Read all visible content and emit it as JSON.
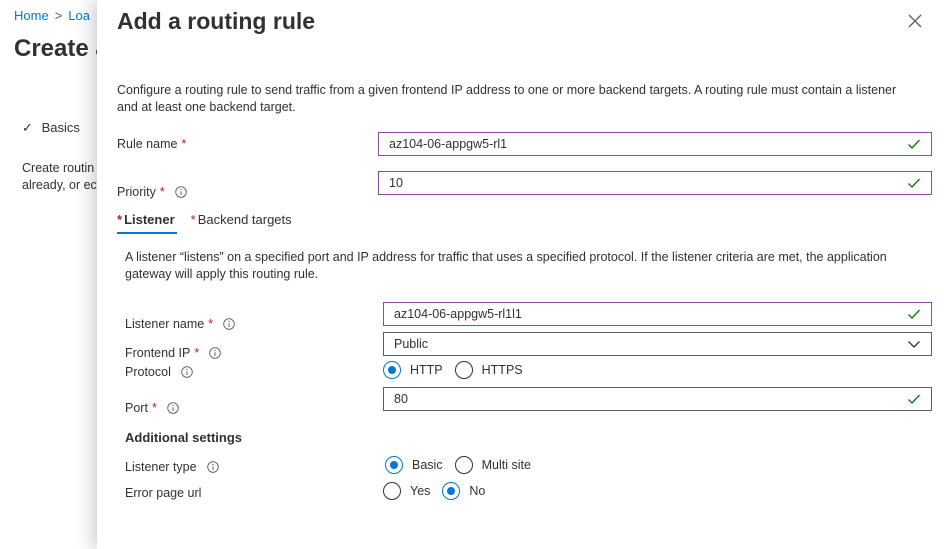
{
  "background": {
    "breadcrumb_home": "Home",
    "breadcrumb_next": "Loa",
    "page_title": "Create a",
    "step_label": "Basics",
    "desc_line1": "Create routin",
    "desc_line2": "already, or ec"
  },
  "panel": {
    "title": "Add a routing rule",
    "intro": "Configure a routing rule to send traffic from a given frontend IP address to one or more backend targets. A routing rule must contain a listener and at least one backend target.",
    "rule_name_label": "Rule name",
    "rule_name_value": "az104-06-appgw5-rl1",
    "priority_label": "Priority",
    "priority_value": "10",
    "required_mark": "*",
    "tabs": [
      {
        "label": "Listener",
        "active": true
      },
      {
        "label": "Backend targets",
        "active": false
      }
    ],
    "listener": {
      "description": "A listener “listens” on a specified port and IP address for traffic that uses a specified protocol. If the listener criteria are met, the application gateway will apply this routing rule.",
      "name_label": "Listener name",
      "name_value": "az104-06-appgw5-rl1l1",
      "frontend_ip_label": "Frontend IP",
      "frontend_ip_value": "Public",
      "protocol_label": "Protocol",
      "protocol_options": [
        "HTTP",
        "HTTPS"
      ],
      "protocol_selected": "HTTP",
      "port_label": "Port",
      "port_value": "80",
      "additional_settings": "Additional settings",
      "listener_type_label": "Listener type",
      "listener_type_options": [
        "Basic",
        "Multi site"
      ],
      "listener_type_selected": "Basic",
      "error_page_label": "Error page url",
      "error_page_options": [
        "Yes",
        "No"
      ],
      "error_page_selected": "No"
    }
  },
  "colors": {
    "accent": "#0078d4",
    "valid": "#107c10",
    "field_border": "#8a4d9e",
    "required": "#a4262c"
  },
  "icons": [
    "close-icon",
    "info-icon",
    "checkmark-icon",
    "chevron-down-icon"
  ]
}
